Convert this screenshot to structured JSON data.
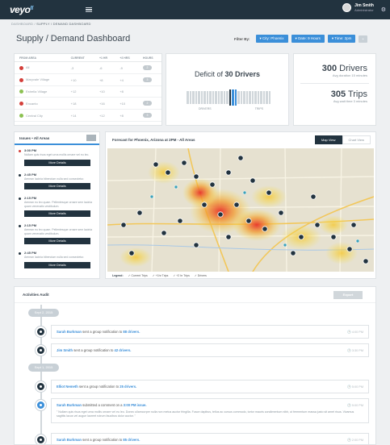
{
  "app": {
    "logo": "veyo",
    "user_name": "Jim Smith",
    "user_role": "Administrator"
  },
  "breadcrumb": {
    "home": "DASHBOARD",
    "sep": "/",
    "current": "SUPPLY / DEMAND DASHBOARD"
  },
  "page": {
    "title": "Supply / Demand Dashboard"
  },
  "filters": {
    "label": "Filter By:",
    "city": "City: Phoenix",
    "date": "Date: 9 Hours",
    "time": "Time: 2pm"
  },
  "stats_table": {
    "headers": [
      "FROM AREA",
      "CURRENT",
      "+1 HR",
      "+2 HRS",
      "HOURS"
    ],
    "rows": [
      {
        "name": "All",
        "color": "#d43f3a",
        "current": "-3",
        "h1": "-6",
        "h2": "-9",
        "hours": "2",
        "neg": true
      },
      {
        "name": "Maryvale Village",
        "color": "#d43f3a",
        "current": "+10",
        "h1": "+8",
        "h2": "+4",
        "hours": "3",
        "neg": false
      },
      {
        "name": "Estrella Village",
        "color": "#8cc152",
        "current": "+12",
        "h1": "+10",
        "h2": "+8",
        "hours": "",
        "neg": false
      },
      {
        "name": "Encanto",
        "color": "#d43f3a",
        "current": "+18",
        "h1": "+16",
        "h2": "+10",
        "hours": "2",
        "neg": false
      },
      {
        "name": "Central City",
        "color": "#8cc152",
        "current": "+14",
        "h1": "+12",
        "h2": "+8",
        "hours": "3",
        "neg": false
      }
    ]
  },
  "deficit": {
    "prefix": "Deficit of",
    "value": "30 Drivers",
    "left_label": "DRIVERS",
    "right_label": "TRIPS"
  },
  "summary": {
    "drivers_value": "300",
    "drivers_unit": "Drivers",
    "drivers_sub": "Avg duration 15 minutes",
    "trips_value": "305",
    "trips_unit": "Trips",
    "trips_sub": "Avg wait time 3 minutes"
  },
  "issues": {
    "title": "Issues • All Areas",
    "button_label": "More Details",
    "items": [
      {
        "time": "3:00 PM",
        "text": "Nullam quis risus eget urna mollis ornare vel eu leo.",
        "urgent": true
      },
      {
        "time": "2:45 PM",
        "text": "Aenean lacinia bibendum nulla sed consectetur.",
        "urgent": false
      },
      {
        "time": "2:15 PM",
        "text": "Aenean eu leo quam. Pellentesque ornare sem lacinia quam venenatis vestibulum.",
        "urgent": false
      },
      {
        "time": "2:15 PM",
        "text": "Aenean eu leo quam. Pellentesque ornare sem lacinia quam venenatis vestibulum.",
        "urgent": false
      },
      {
        "time": "2:45 PM",
        "text": "Aenean lacinia bibendum nulla sed consectetur.",
        "urgent": false
      }
    ]
  },
  "map": {
    "title": "Forecast for Phoenix, Arizona at 2PM - All Areas",
    "tab_map": "Map View",
    "tab_chart": "Chart View",
    "legend_label": "Legend:",
    "legend_items": [
      "Current Trips",
      "+1hr Trips",
      "+2 hr Trips",
      "Drivers"
    ]
  },
  "activity": {
    "title": "Activities Audit",
    "button": "Export",
    "groups": [
      {
        "date": "Sept 2, 2015"
      },
      {
        "date": "Sept 1, 2015"
      }
    ],
    "items": [
      {
        "name": "Sarah Burkman",
        "action": "sent a group notification to",
        "target": "88 drivers.",
        "time": "4:00 PM"
      },
      {
        "name": "Jim Smith",
        "action": "sent a group notification to",
        "target": "42 drivers.",
        "time": "3:30 PM"
      },
      {
        "name": "Elliot Nemeth",
        "action": "sent a group notification to",
        "target": "25 drivers.",
        "time": "5:00 PM"
      },
      {
        "name": "Sarah Burkman",
        "action": "submitted a comment on a",
        "target": "3:00 PM issue.",
        "time": "5:00 PM",
        "body": "\" Nullam quis risus eget urna mollis ornare vel eu leo. Donec ullamcorper nulla non metus auctor fringilla. Fusce dapibus, tellus ac cursus commodo, tortor mauris condimentum nibh, ut fermentum massa justo sit amet risus. Vivamus sagittis lacus vel augue laoreet rutrum faucibus dolor auctor. \""
      },
      {
        "name": "Sarah Burkman",
        "action": "sent a group notification to",
        "target": "85 drivers.",
        "time": "2:00 PM"
      }
    ]
  },
  "colors": {
    "navy": "#22333f",
    "accent": "#3b8fd9",
    "negative": "#d43f3a"
  }
}
